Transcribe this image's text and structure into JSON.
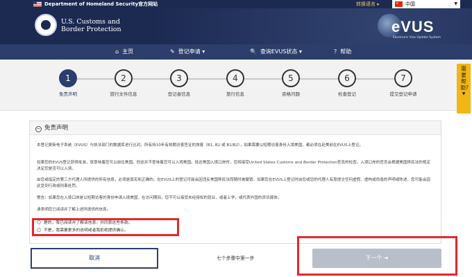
{
  "topbar": {
    "agency": "Department of Homeland Security官方网站",
    "language_label": "转换语言 ▸",
    "language_value": "中国",
    "language_caret": "▼"
  },
  "header": {
    "cbp_line1": "U.S. Customs and",
    "cbp_line2": "Border Protection",
    "evus_logo": "eVUS",
    "evus_tagline": "Electronic Visa Update System"
  },
  "nav": {
    "items": [
      {
        "icon": "⌂",
        "label": "主页",
        "caret": ""
      },
      {
        "icon": "✎",
        "label": "登记申请",
        "caret": "▾"
      },
      {
        "icon": "🔍",
        "label": "查询EVUS状态",
        "caret": "▾"
      },
      {
        "icon": "?",
        "label": "帮助",
        "caret": ""
      }
    ]
  },
  "steps": [
    {
      "number": "1",
      "label": "免责声明"
    },
    {
      "number": "2",
      "label": "旅行文件信息"
    },
    {
      "number": "3",
      "label": "登记者信息"
    },
    {
      "number": "4",
      "label": "旅行信息"
    },
    {
      "number": "5",
      "label": "资格问题"
    },
    {
      "number": "6",
      "label": "检查登记"
    },
    {
      "number": "7",
      "label": "提交登记申请"
    }
  ],
  "help_tab": {
    "label": "需要帮助?",
    "caret": "▼"
  },
  "panel": {
    "title": "免责声明",
    "paragraphs": [
      "本登记更新电子系统（EVUS）与执法部门的数据库进行比对。所有持10年有效期访客签证的旅客（B1, B2 或 B1/B2），如果需要以短期访客身份入境美国，都必须在赴美前在EVUS上登记。",
      "如果您的EVUS登记获得批准，就意味着您可以前往美国。但这并不意味着您可以入境美国。抵达美国入境口岸时，您将接受United States Customs and Border Protection官员的检查。入境口岸的官员会根据美国移民法的规定决定您是否可以入境。",
      "由您或指定的第三方代理人所提供的所有信息，必须是真实和正确的。在EVUS上的登记可能会因违反美国移民法而随时被撤销。如果您在EVUS上登记时由您或您的代理人有意提交任何虚假、虚构或伪造的声明或陈述，您可能会因此受到行政或刑事处罚。",
      "警告：如果您在入境口岸是以短期访客的身份申请入境美国，在访问期间，您不可以接受未经授权的就业，或者上学，或代表外国的资讯媒体。",
      "请表明您已阅读并了解上述所提供的信息。"
    ],
    "options": [
      "是的，我已阅读并了解该信息，并同意这些条款。",
      "不是，我需要更多的说明或者我拒绝提供确认。"
    ]
  },
  "footer": {
    "cancel_label": "取消",
    "progress_text": "七个步骤中第一步",
    "next_label": "下一个 ➜"
  }
}
